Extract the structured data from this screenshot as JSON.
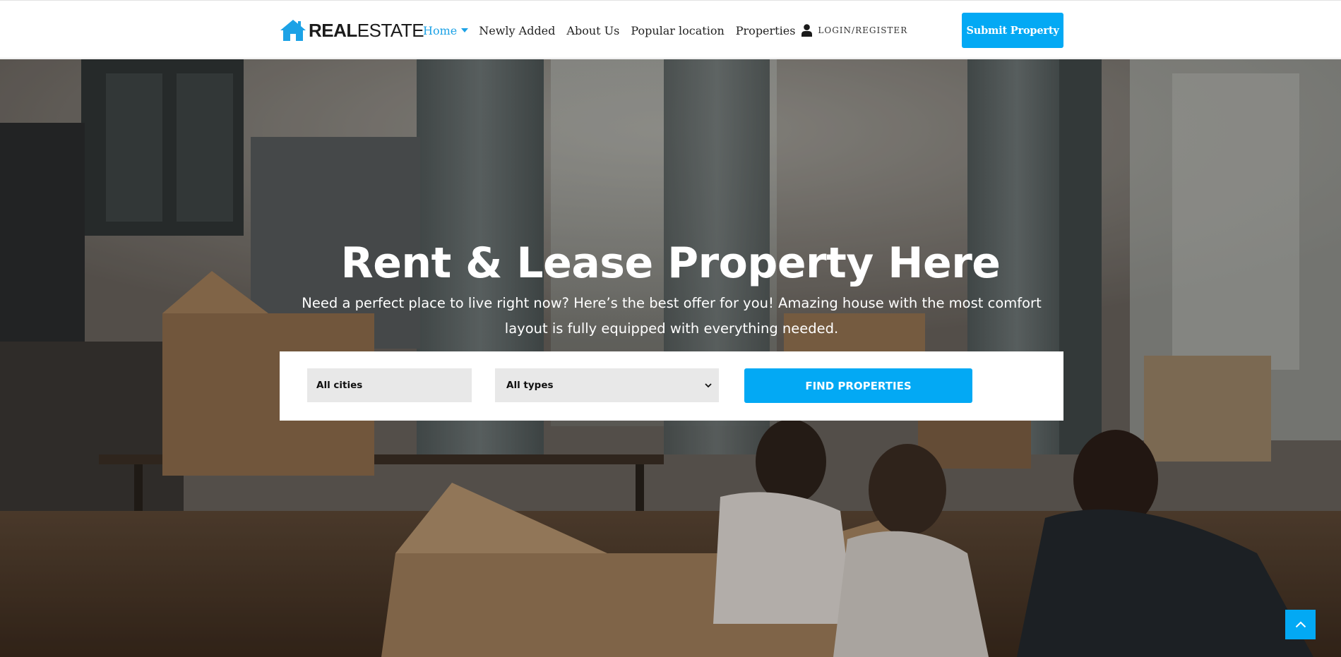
{
  "brand": {
    "logo_bold": "REAL",
    "logo_light": "ESTATE",
    "accent_color": "#03a9f4"
  },
  "nav": {
    "items": [
      {
        "label": "Home",
        "active": true,
        "has_dropdown": true
      },
      {
        "label": "Newly Added"
      },
      {
        "label": "About Us"
      },
      {
        "label": "Popular location"
      },
      {
        "label": "Properties"
      }
    ],
    "login_label": "LOGIN/REGISTER",
    "login_icon": "user-icon",
    "submit_label": "Submit Property"
  },
  "hero": {
    "title": "Rent & Lease Property Here",
    "subtitle": "Need a perfect place to live right now? Here’s the best offer for you! Amazing house with the most comfort layout is fully equipped with everything needed."
  },
  "search": {
    "city_value": "All cities",
    "type_value": "All types",
    "find_label": "FIND PROPERTIES"
  },
  "scroll_top_icon": "chevron-up-icon"
}
